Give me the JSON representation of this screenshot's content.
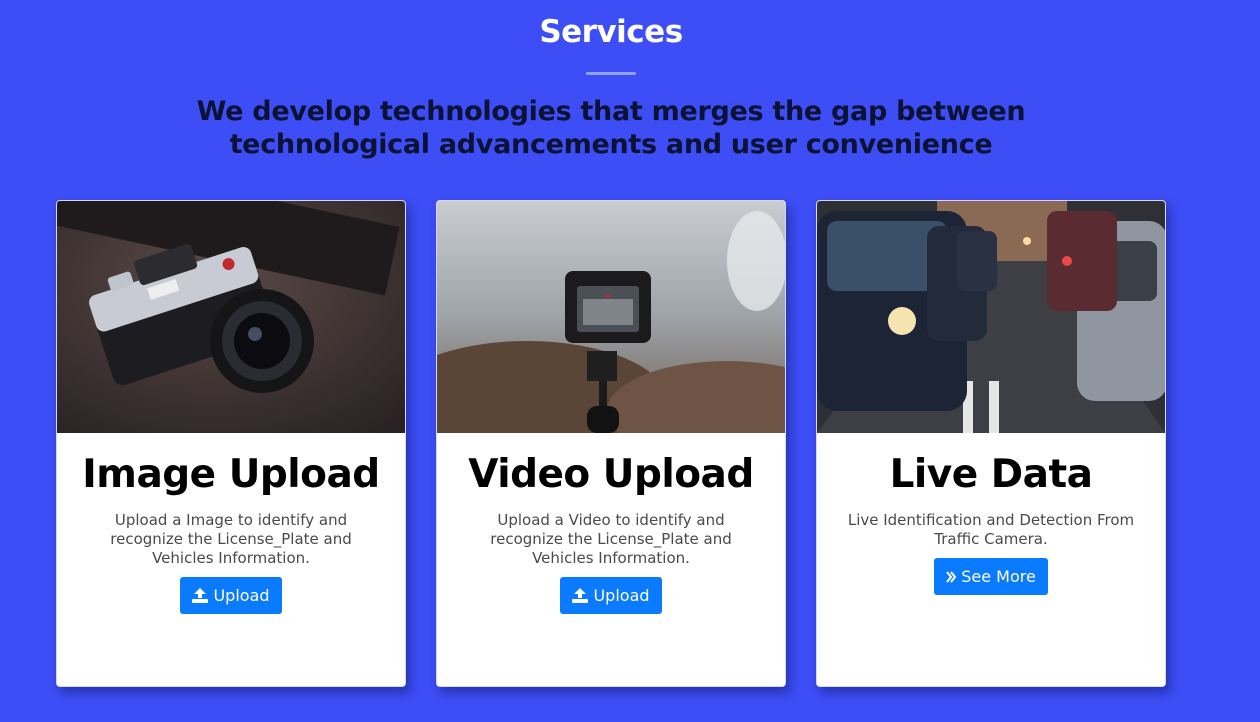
{
  "section": {
    "title": "Services",
    "tagline": "We develop technologies that merges the gap between technological advancements and user convenience"
  },
  "cards": [
    {
      "title": "Image Upload",
      "text": "Upload a Image to identify and recognize the License_Plate and Vehicles Information.",
      "button_label": "Upload",
      "button_icon": "upload-icon",
      "image": "camera-photo"
    },
    {
      "title": "Video Upload",
      "text": "Upload a Video to identify and recognize the License_Plate and Vehicles Information.",
      "button_label": "Upload",
      "button_icon": "upload-icon",
      "image": "action-camera-photo"
    },
    {
      "title": "Live Data",
      "text": "Live Identification and Detection From Traffic Camera.",
      "button_label": "See More",
      "button_icon": "double-chevron-right-icon",
      "image": "traffic-photo"
    }
  ],
  "colors": {
    "background": "#3d4ef6",
    "button": "#0a7bff",
    "card": "#ffffff"
  }
}
